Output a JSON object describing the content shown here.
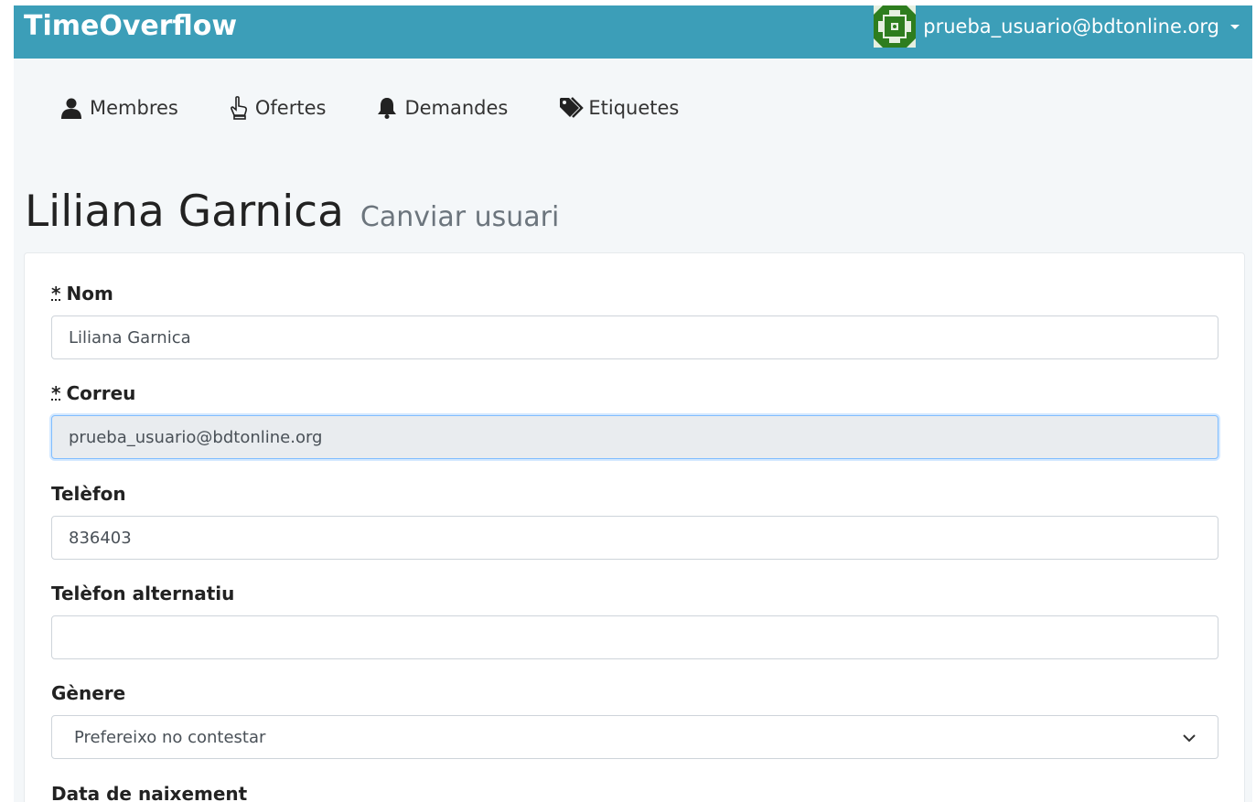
{
  "navbar": {
    "brand": "TimeOverflow",
    "user_email": "prueba_usuario@bdtonline.org",
    "colors": {
      "bar": "#3c9eb8",
      "avatar": "#2e7d1e"
    }
  },
  "subnav": {
    "items": [
      {
        "label": "Membres",
        "icon": "user-icon"
      },
      {
        "label": "Ofertes",
        "icon": "hand-pointer-icon"
      },
      {
        "label": "Demandes",
        "icon": "bell-icon"
      },
      {
        "label": "Etiquetes",
        "icon": "tags-icon"
      }
    ]
  },
  "page": {
    "title": "Liliana Garnica",
    "subtitle": "Canviar usuari"
  },
  "form": {
    "required_marker": "*",
    "fields": {
      "name": {
        "label": "Nom",
        "value": "Liliana Garnica",
        "required": true
      },
      "email": {
        "label": "Correu",
        "value": "prueba_usuario@bdtonline.org",
        "required": true,
        "readonly": true
      },
      "phone": {
        "label": "Telèfon",
        "value": "836403"
      },
      "alt_phone": {
        "label": "Telèfon alternatiu",
        "value": ""
      },
      "gender": {
        "label": "Gènere",
        "selected": "Prefereixo no contestar"
      },
      "birthdate": {
        "label": "Data de naixement"
      }
    }
  }
}
